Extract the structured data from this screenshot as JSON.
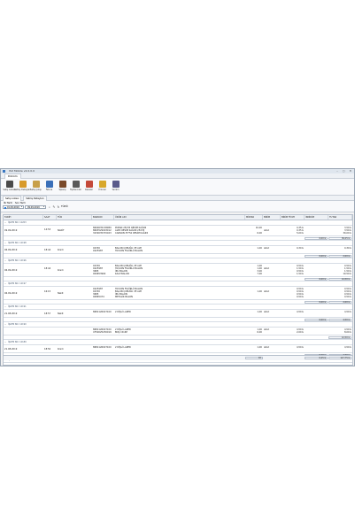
{
  "window": {
    "title": "ISU Mobile v2.0.0.0",
    "controls": "–  ▢  ✕"
  },
  "menu": {
    "tab": "Döküm"
  },
  "ribbon": [
    {
      "label": "Satış Listesi",
      "icon": "list-icon",
      "color": "#4a4a4a"
    },
    {
      "label": "Satılış Detayları",
      "icon": "receipt-icon",
      "color": "#d89a2b"
    },
    {
      "label": "Satış Çıkışı",
      "icon": "box-icon",
      "color": "#c8a04a"
    },
    {
      "label": "Fatura",
      "icon": "invoice-icon",
      "color": "#3a6fb8"
    },
    {
      "label": "Sipariş",
      "icon": "order-icon",
      "color": "#7a4a2a"
    },
    {
      "label": "Toptancılar",
      "icon": "tools-icon",
      "color": "#5a5a5a"
    },
    {
      "label": "Kasalar",
      "icon": "register-icon",
      "color": "#c44a3a"
    },
    {
      "label": "Ürünler",
      "icon": "product-icon",
      "color": "#d8a82b"
    },
    {
      "label": "Yardım",
      "icon": "help-icon",
      "color": "#5a5a8a"
    }
  ],
  "doc_tabs": [
    "Satış Listesi",
    "Satılış Detayları"
  ],
  "filters": {
    "start_label": "İlk Tarih",
    "end_label": "Son Tarih",
    "start_date": "01.09.2019",
    "end_date": "09.09.2019",
    "all_label": "TÜMÜ"
  },
  "columns": [
    "TARİH",
    "SAAT",
    "TÜR",
    "BARKOD",
    "ÜRÜN ADI",
    "MİKTAR",
    "BİRİM",
    "BİRİM FİYATI",
    "İNDİRİM",
    "TUTAR"
  ],
  "groups": [
    {
      "title": "İŞLEM NO: 12203",
      "date": "09.09.2019",
      "time": "14:53",
      "type": "NAKİT",
      "items": [
        {
          "barcode": "8690635138989",
          "name": "POPAN 25X35 RESİM KAĞIDI",
          "qty": "10,00",
          "unit": "",
          "price": "0,35 ₺",
          "total": "3,50 ₺"
        },
        {
          "barcode": "8693529003012",
          "name": "ALEX RESİM KAĞIDI 25X35",
          "qty": "",
          "unit": "Adet",
          "price": "0,35 ₺",
          "total": "3,50 ₺"
        },
        {
          "barcode": "3230035370023",
          "name": "CANSON 35*50 RESİM KAĞIDI",
          "qty": "6,00",
          "unit": "",
          "price": "5,00 ₺",
          "total": "30,00 ₺"
        }
      ],
      "sum_price": "0,00 ₺",
      "sum_total": "36,25 ₺"
    },
    {
      "title": "İŞLEM NO: 12198",
      "date": "06.09.2019",
      "time": "18:44",
      "type": "Kredi",
      "items": [
        {
          "barcode": "02330",
          "name": "BALON ÇUBUĞU VE ALTI",
          "qty": "1,00",
          "unit": "Adet",
          "price": "0,30 ₺",
          "total": "0,30 ₺"
        },
        {
          "barcode": "0225987",
          "name": "HAYVAN FIGÜRLÜ BALON",
          "qty": "",
          "unit": "",
          "price": "",
          "total": ""
        }
      ],
      "sum_price": "0,00 ₺",
      "sum_total": "2,00 ₺"
    },
    {
      "title": "İŞLEM NO: 12196",
      "date": "06.09.2019",
      "time": "18:44",
      "type": "Kredi",
      "items": [
        {
          "barcode": "02330",
          "name": "BALON ÇUBUĞU VE ALTI",
          "qty": "1,00",
          "unit": "",
          "price": "0,50 ₺",
          "total": "0,50 ₺"
        },
        {
          "barcode": "0225987",
          "name": "HAYVAN FIGÜRLÜ BALON",
          "qty": "1,00",
          "unit": "Adet",
          "price": "1,50 ₺",
          "total": "1,50 ₺"
        },
        {
          "barcode": "3685",
          "name": "İPLİ BALON",
          "qty": "3,00",
          "unit": "",
          "price": "0,50 ₺",
          "total": "1,50 ₺"
        },
        {
          "barcode": "009653964",
          "name": "KALP BALON",
          "qty": "7,00",
          "unit": "",
          "price": "1,50 ₺",
          "total": "10,50 ₺"
        }
      ],
      "sum_price": "0,00 ₺",
      "sum_total": "14,50 ₺"
    },
    {
      "title": "İŞLEM NO: 12197",
      "date": "06.09.2019",
      "time": "16:15",
      "type": "Nakit",
      "items": [
        {
          "barcode": "0225987",
          "name": "HAYVAN FIGÜRLÜ BALON",
          "qty": "",
          "unit": "",
          "price": "0,50 ₺",
          "total": "0,50 ₺"
        },
        {
          "barcode": "02330",
          "name": "BALON ÇUBUĞU VE ALTI",
          "qty": "1,00",
          "unit": "Adet",
          "price": "0,50 ₺",
          "total": "0,50 ₺"
        },
        {
          "barcode": "3685",
          "name": "İPLİ BALON",
          "qty": "",
          "unit": "",
          "price": "0,50 ₺",
          "total": "0,50 ₺"
        },
        {
          "barcode": "00865474",
          "name": "METALİK BALON",
          "qty": "",
          "unit": "",
          "price": "0,50 ₺",
          "total": "0,50 ₺"
        }
      ],
      "sum_price": "0,00 ₺",
      "sum_total": "2,00 ₺"
    },
    {
      "title": "İŞLEM NO: 12191",
      "date": "21.08.2019",
      "time": "18:57",
      "type": "Nakit",
      "items": [
        {
          "barcode": "8681126027100",
          "name": "2 DİŞLİ LAZER",
          "qty": "1,00",
          "unit": "Adet",
          "price": "4,50 ₺",
          "total": "4,50 ₺"
        }
      ],
      "sum_price": "0,00 ₺",
      "sum_total": "4,50 ₺"
    },
    {
      "title": "İŞLEM NO: 12190",
      "date": "",
      "time": "",
      "type": "",
      "items": [
        {
          "barcode": "8681126027100",
          "name": "2 DİŞLİ LAZER",
          "qty": "1,00",
          "unit": "Adet",
          "price": "4,50 ₺",
          "total": "4,50 ₺"
        },
        {
          "barcode": "4750025230019",
          "name": "BOŞ CD-RP",
          "qty": "6,00",
          "unit": "",
          "price": "2,00 ₺",
          "total": "8,00 ₺"
        }
      ],
      "sum_price": "",
      "sum_total": "12,50 ₺"
    },
    {
      "title": "İŞLEM NO: 12189",
      "date": "21.08.2019",
      "time": "18:50",
      "type": "Kredi",
      "items": [
        {
          "barcode": "8681126027100",
          "name": "2 DİŞLİ LAZER",
          "qty": "1,00",
          "unit": "Adet",
          "price": "4,50 ₺",
          "total": "4,50 ₺"
        }
      ],
      "sum_price": "0,00 ₺",
      "sum_total": "4,50 ₺"
    },
    {
      "title": "İŞLEM NO: 12181",
      "date": "",
      "time": "",
      "type": "",
      "items": [],
      "sum_price": "",
      "sum_total": ""
    }
  ],
  "totals": {
    "qty": "87",
    "discount": "0,25 ₺",
    "total": "117,75 ₺"
  }
}
